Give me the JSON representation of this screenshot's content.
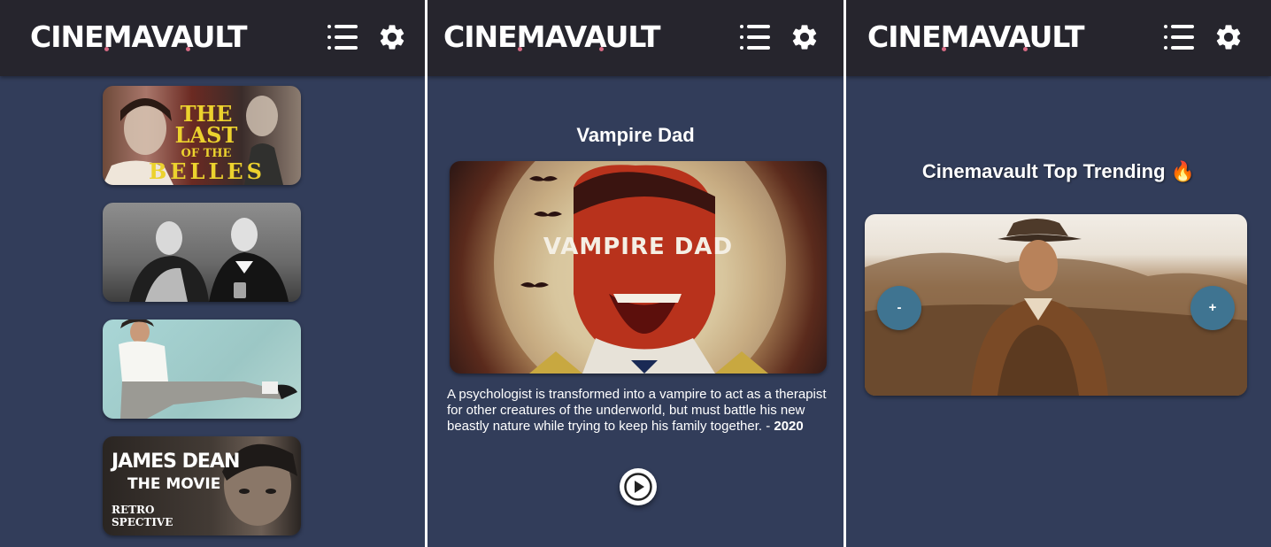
{
  "brand": {
    "logo_text": "CINEMAVAULT",
    "dot_color": "#d76b84",
    "header_bg": "#26252d",
    "page_bg": "#323d5a"
  },
  "header": {
    "menu_icon": "list-icon",
    "settings_icon": "gear-icon"
  },
  "catalog": {
    "posters": [
      {
        "title_lines": [
          "THE LAST",
          "OF THE",
          "BELLES"
        ]
      },
      {
        "title_lines": []
      },
      {
        "title_lines": []
      },
      {
        "title_lines": [
          "JAMES DEAN",
          "THE MOVIE",
          "RETRO",
          "SPECTIVE"
        ]
      }
    ]
  },
  "detail": {
    "title": "Vampire Dad",
    "poster_text": "VAMPIRE DAD",
    "description": "A psychologist is transformed into a vampire to act as a therapist for other creatures of the underworld, but must battle his new beastly nature while trying to keep his family together. - ",
    "year": "2020",
    "play_icon": "play-icon"
  },
  "trending": {
    "heading": "Cinemavault Top Trending",
    "emoji": "🔥",
    "prev_label": "-",
    "next_label": "+"
  }
}
